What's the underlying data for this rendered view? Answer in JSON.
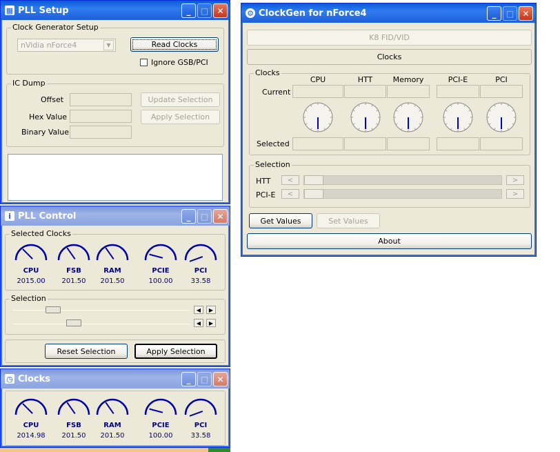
{
  "colors": {
    "titlebar": "#1f5fd8",
    "window_bg": "#ece9d8",
    "gauge_blue": "#0000aa"
  },
  "pll_setup": {
    "title": "PLL Setup",
    "group_clock_gen": "Clock Generator Setup",
    "chipset": "nVidia nForce4",
    "read_clocks": "Read Clocks",
    "ignore_gsb": "Ignore GSB/PCI",
    "group_ic_dump": "IC Dump",
    "offset": "Offset",
    "hex_value": "Hex Value",
    "binary_value": "Binary Value",
    "update_selection": "Update Selection",
    "apply_selection": "Apply Selection"
  },
  "pll_control": {
    "title": "PLL Control",
    "group_selected": "Selected Clocks",
    "gauges": [
      {
        "label": "CPU",
        "value": "2015.00"
      },
      {
        "label": "FSB",
        "value": "201.50"
      },
      {
        "label": "RAM",
        "value": "201.50"
      },
      {
        "label": "PCIE",
        "value": "100.00"
      },
      {
        "label": "PCI",
        "value": "33.58"
      }
    ],
    "group_selection": "Selection",
    "slider1_level": 0.2,
    "slider2_level": 0.33,
    "reset_selection": "Reset Selection",
    "apply_selection": "Apply Selection"
  },
  "clocks": {
    "title": "Clocks",
    "gauges": [
      {
        "label": "CPU",
        "value": "2014.98"
      },
      {
        "label": "FSB",
        "value": "201.50"
      },
      {
        "label": "RAM",
        "value": "201.50"
      },
      {
        "label": "PCIE",
        "value": "100.00"
      },
      {
        "label": "PCI",
        "value": "33.58"
      }
    ]
  },
  "clockgen": {
    "title": "ClockGen for nForce4",
    "k8_fid_vid": "K8 FID/VID",
    "clocks_tab": "Clocks",
    "group_clocks": "Clocks",
    "columns": [
      "CPU",
      "HTT",
      "Memory",
      "PCI-E",
      "PCI"
    ],
    "row_current": "Current",
    "row_selected": "Selected",
    "group_selection": "Selection",
    "htt": "HTT",
    "pcie": "PCI-E",
    "get_values": "Get Values",
    "set_values": "Set Values",
    "about": "About"
  }
}
